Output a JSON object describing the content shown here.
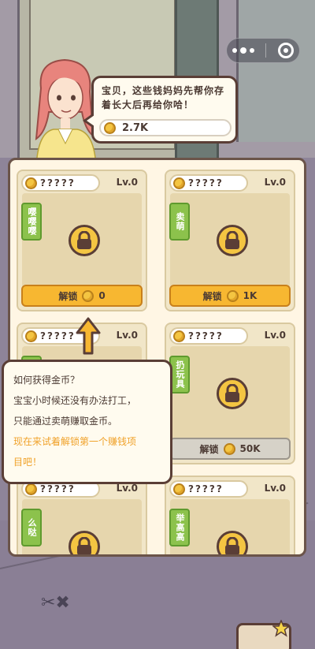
{
  "bubble": {
    "message": "宝贝，这些钱妈妈先帮你存着长大后再给你哈！",
    "coins": "2.7K"
  },
  "cards": [
    {
      "name": "?????",
      "level": "Lv.0",
      "tag": "嘤嘤嘤",
      "unlock_label": "解锁",
      "price": "0",
      "style": "gold"
    },
    {
      "name": "?????",
      "level": "Lv.0",
      "tag": "卖萌",
      "unlock_label": "解锁",
      "price": "1K",
      "style": "gold"
    },
    {
      "name": "?????",
      "level": "Lv.0",
      "tag": "",
      "unlock_label": "",
      "price": "",
      "style": "hidden"
    },
    {
      "name": "?????",
      "level": "Lv.0",
      "tag": "扔玩具",
      "unlock_label": "解锁",
      "price": "50K",
      "style": "gray"
    },
    {
      "name": "?????",
      "level": "Lv.0",
      "tag": "么哒",
      "unlock_label": "",
      "price": "",
      "style": "hidden"
    },
    {
      "name": "?????",
      "level": "Lv.0",
      "tag": "举高高",
      "unlock_label": "",
      "price": "",
      "style": "hidden"
    }
  ],
  "tip": {
    "line1": "如何获得金币？",
    "line2": "宝宝小时候还没有办法打工，",
    "line3": "只能通过卖萌赚取金币。",
    "line4": "现在来试着解锁第一个赚钱项",
    "line5": "目吧！"
  },
  "colors": {
    "accent": "#f7b731",
    "highlight": "#f0a22a",
    "tag_green": "#8cc24c",
    "outline": "#5a3e36"
  }
}
